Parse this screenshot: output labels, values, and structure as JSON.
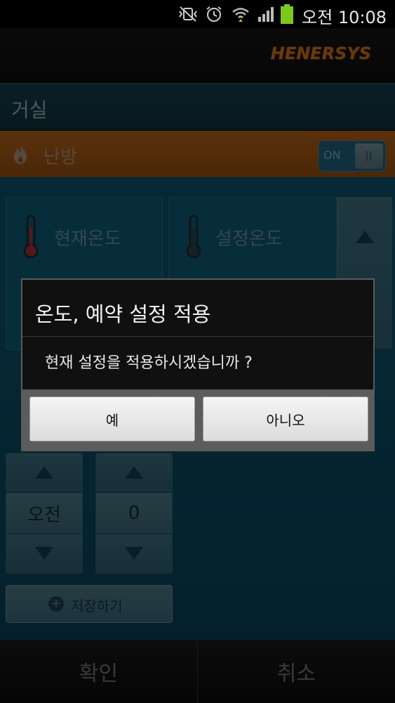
{
  "status_bar": {
    "time": "오전 10:08",
    "icons": [
      "mute-vibrate-icon",
      "alarm-icon",
      "wifi-icon",
      "signal-icon",
      "battery-icon"
    ]
  },
  "header": {
    "brand": "HENERSYS"
  },
  "room": {
    "title": "거실"
  },
  "mode": {
    "label": "난방",
    "icon": "flame-icon",
    "toggle_label": "ON",
    "toggle_state": "on"
  },
  "temperature": {
    "current_label": "현재온도",
    "set_label": "설정온도",
    "icon": "thermometer-icon"
  },
  "schedule": {
    "ampm_value": "오전",
    "hour_value": "0",
    "save_label": "저장하기"
  },
  "bottom_bar": {
    "confirm_label": "확인",
    "cancel_label": "취소"
  },
  "dialog": {
    "title": "온도, 예약 설정 적용",
    "message": "현재 설정을 적용하시겠습니까 ?",
    "yes_label": "예",
    "no_label": "아니오"
  },
  "colors": {
    "brand_orange": "#c8701b",
    "heating_bar": "#a65a16",
    "teal_bg": "#0c4a62",
    "dialog_bg": "#101010"
  }
}
